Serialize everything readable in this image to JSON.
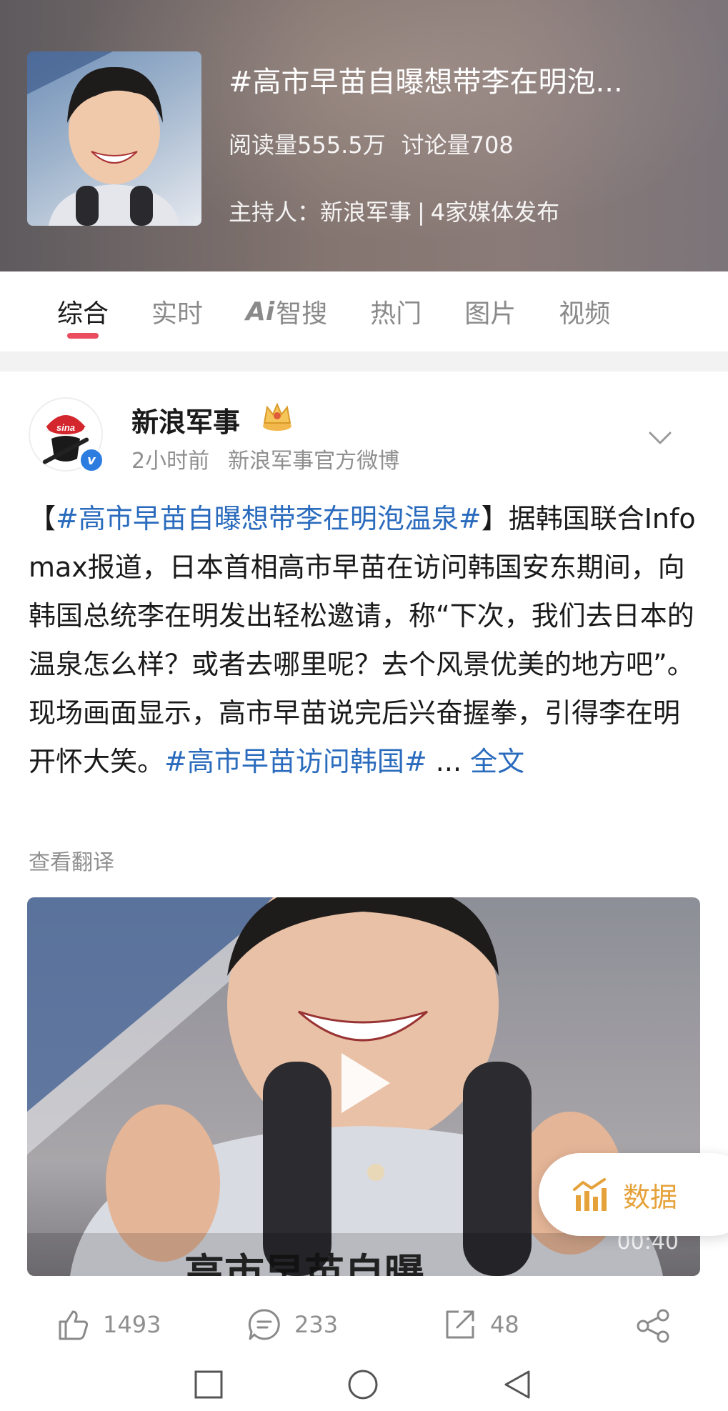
{
  "topic": {
    "title": "#高市早苗自曝想带李在明泡...",
    "reads": "阅读量555.5万",
    "discussions": "讨论量708",
    "host_label": "主持人：新浪军事",
    "separator": "|",
    "media": "4家媒体发布"
  },
  "tabs": [
    {
      "label": "综合",
      "active": true
    },
    {
      "label": "实时"
    },
    {
      "ai_prefix": "Ai",
      "label": "智搜"
    },
    {
      "label": "热门"
    },
    {
      "label": "图片"
    },
    {
      "label": "视频"
    }
  ],
  "post": {
    "author": "新浪军事",
    "avatar_text": "sina",
    "verified_mark": "v",
    "time": "2小时前",
    "source": "新浪军事官方微博",
    "text": {
      "open_bracket": "【",
      "hashtag1": "#高市早苗自曝想带李在明泡温泉#",
      "close_bracket": "】",
      "body": "据韩国联合Infomax报道，日本首相高市早苗在访问韩国安东期间，向韩国总统李在明发出轻松邀请，称“下次，我们去日本的温泉怎么样？或者去哪里呢？去个风景优美的地方吧”。现场画面显示，高市早苗说完后兴奋握拳，引得李在明开怀大笑。",
      "hashtag2": "#高市早苗访问韩国#",
      "ellipsis": " ... ",
      "more": "全文"
    },
    "translate": "查看翻译",
    "video": {
      "duration": "00:40",
      "caption": "高市早苗自曝"
    }
  },
  "data_button": {
    "label": "数据"
  },
  "actions": {
    "likes": "1493",
    "comments": "233",
    "reposts": "48"
  },
  "colors": {
    "accent_red": "#ea4d5e",
    "link_blue": "#2a6bbd",
    "data_orange": "#e6a23a"
  }
}
